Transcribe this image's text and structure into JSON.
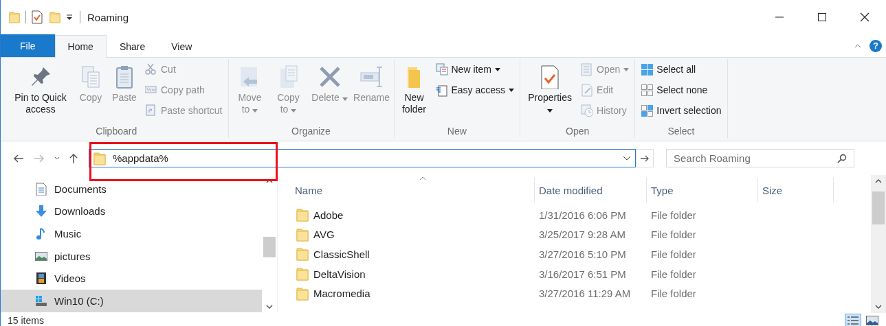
{
  "window": {
    "title": "Roaming",
    "help": "?"
  },
  "ribbon_tabs": [
    {
      "label": "File",
      "kind": "file",
      "selected": false
    },
    {
      "label": "Home",
      "kind": "tab",
      "selected": true
    },
    {
      "label": "Share",
      "kind": "tab",
      "selected": false
    },
    {
      "label": "View",
      "kind": "tab",
      "selected": false
    }
  ],
  "ribbon_groups": [
    {
      "label": "Clipboard",
      "commands": [
        {
          "label": "Pin to Quick access",
          "kind": "large",
          "disabled": false,
          "dropdown": false
        },
        {
          "label": "Copy",
          "kind": "large",
          "disabled": true,
          "dropdown": false
        },
        {
          "label": "Paste",
          "kind": "large",
          "disabled": true,
          "dropdown": false
        },
        {
          "label": "Cut",
          "kind": "small",
          "disabled": true,
          "dropdown": false
        },
        {
          "label": "Copy path",
          "kind": "small",
          "disabled": true,
          "dropdown": false
        },
        {
          "label": "Paste shortcut",
          "kind": "small",
          "disabled": true,
          "dropdown": false
        }
      ]
    },
    {
      "label": "Organize",
      "commands": [
        {
          "label": "Move to",
          "kind": "large",
          "disabled": true,
          "dropdown": true
        },
        {
          "label": "Copy to",
          "kind": "large",
          "disabled": true,
          "dropdown": true
        },
        {
          "label": "Delete",
          "kind": "large",
          "disabled": true,
          "dropdown": true
        },
        {
          "label": "Rename",
          "kind": "large",
          "disabled": true,
          "dropdown": false
        }
      ]
    },
    {
      "label": "New",
      "commands": [
        {
          "label": "New folder",
          "kind": "large",
          "disabled": false,
          "dropdown": false
        },
        {
          "label": "New item",
          "kind": "small",
          "disabled": false,
          "dropdown": true
        },
        {
          "label": "Easy access",
          "kind": "small",
          "disabled": false,
          "dropdown": true
        }
      ]
    },
    {
      "label": "Open",
      "commands": [
        {
          "label": "Properties",
          "kind": "large",
          "disabled": false,
          "dropdown": true
        },
        {
          "label": "Open",
          "kind": "small",
          "disabled": true,
          "dropdown": true
        },
        {
          "label": "Edit",
          "kind": "small",
          "disabled": true,
          "dropdown": false
        },
        {
          "label": "History",
          "kind": "small",
          "disabled": true,
          "dropdown": false
        }
      ]
    },
    {
      "label": "Select",
      "commands": [
        {
          "label": "Select all",
          "kind": "small",
          "disabled": false,
          "dropdown": false
        },
        {
          "label": "Select none",
          "kind": "small",
          "disabled": false,
          "dropdown": false
        },
        {
          "label": "Invert selection",
          "kind": "small",
          "disabled": false,
          "dropdown": false
        }
      ]
    }
  ],
  "address_bar": {
    "value": "%appdata%",
    "highlighted": true
  },
  "search": {
    "placeholder": "Search Roaming"
  },
  "nav_pane": {
    "items": [
      {
        "label": "Documents",
        "selected": false
      },
      {
        "label": "Downloads",
        "selected": false
      },
      {
        "label": "Music",
        "selected": false
      },
      {
        "label": "pictures",
        "selected": false
      },
      {
        "label": "Videos",
        "selected": false
      },
      {
        "label": "Win10 (C:)",
        "selected": true
      }
    ]
  },
  "file_list": {
    "columns": [
      "Name",
      "Date modified",
      "Type",
      "Size"
    ],
    "rows": [
      {
        "name": "Adobe",
        "date_modified": "1/31/2016 6:06 PM",
        "type": "File folder"
      },
      {
        "name": "AVG",
        "date_modified": "3/25/2017 9:28 AM",
        "type": "File folder"
      },
      {
        "name": "ClassicShell",
        "date_modified": "3/27/2016 5:10 PM",
        "type": "File folder"
      },
      {
        "name": "DeltaVision",
        "date_modified": "3/16/2017 6:51 PM",
        "type": "File folder"
      },
      {
        "name": "Macromedia",
        "date_modified": "3/27/2016 11:29 AM",
        "type": "File folder"
      }
    ]
  },
  "status_bar": {
    "item_count": "15 items"
  },
  "view_buttons": [
    {
      "kind": "details",
      "selected": true
    },
    {
      "kind": "large_icons",
      "selected": false
    }
  ]
}
